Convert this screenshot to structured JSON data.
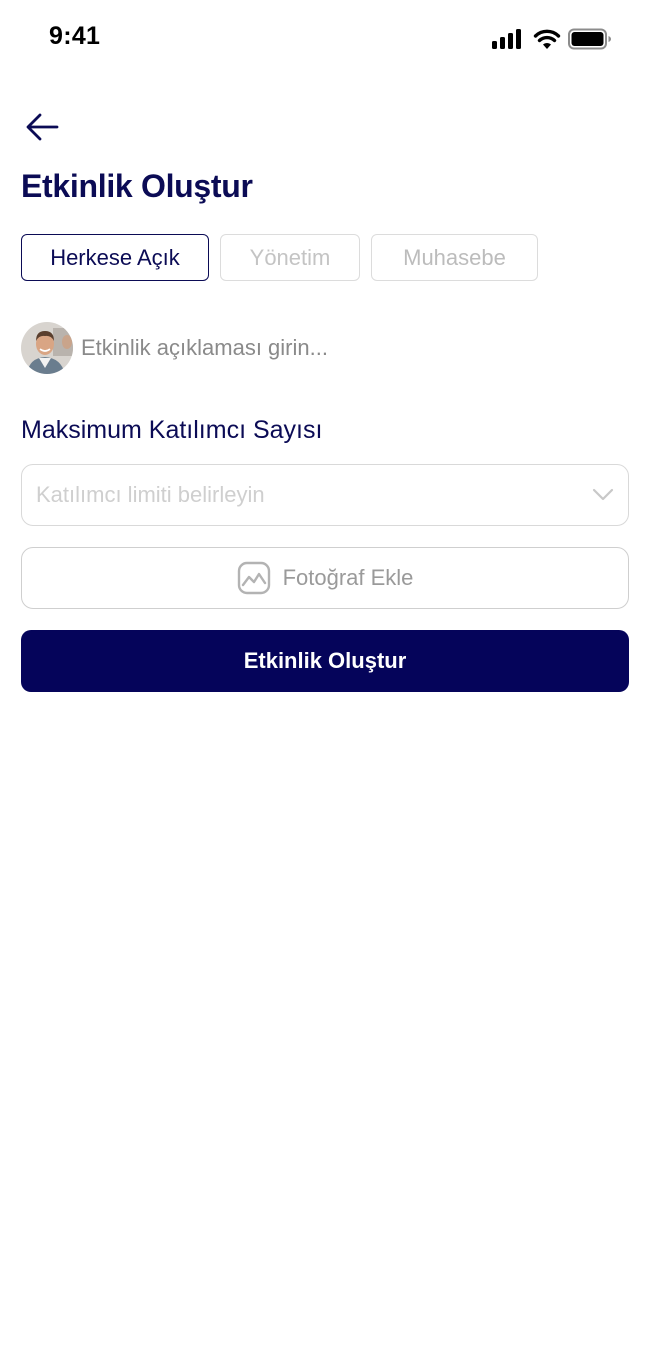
{
  "status_bar": {
    "time": "9:41"
  },
  "header": {
    "title": "Etkinlik Oluştur"
  },
  "tabs": [
    {
      "label": "Herkese Açık",
      "active": true
    },
    {
      "label": "Yönetim",
      "active": false
    },
    {
      "label": "Muhasebe",
      "active": false
    }
  ],
  "description": {
    "placeholder": "Etkinlik açıklaması girin...",
    "value": ""
  },
  "participants": {
    "label": "Maksimum Katılımcı Sayısı",
    "placeholder": "Katılımcı limiti belirleyin"
  },
  "photo_button": {
    "label": "Fotoğraf Ekle"
  },
  "submit_button": {
    "label": "Etkinlik Oluştur"
  },
  "colors": {
    "primary": "#05045a",
    "title": "#0b0b55",
    "border": "#d9d9d9",
    "placeholder": "#cfcfcf"
  },
  "icons": [
    "signal-icon",
    "wifi-icon",
    "battery-icon",
    "back-arrow-icon",
    "chevron-down-icon",
    "image-icon"
  ]
}
